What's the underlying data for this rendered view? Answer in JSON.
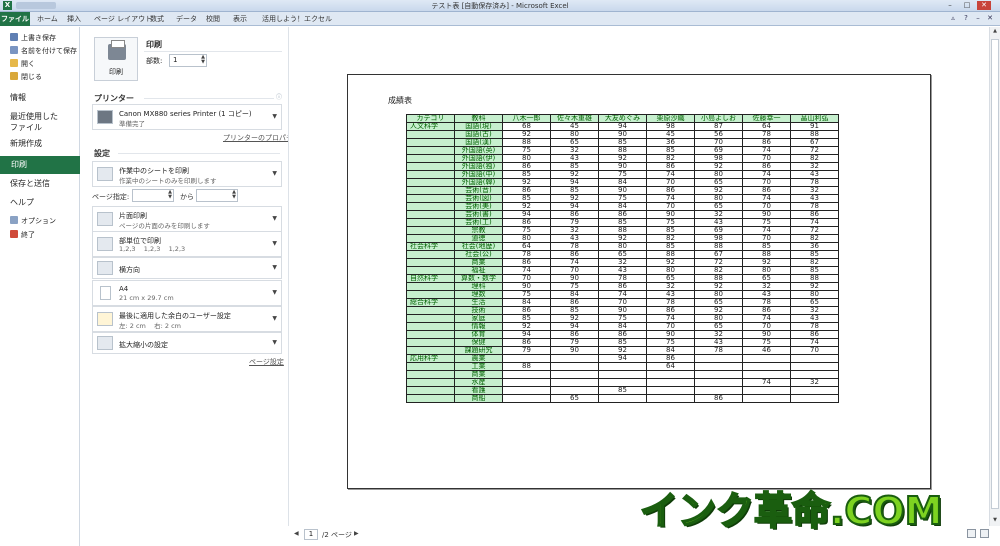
{
  "window": {
    "title": "テスト表 [自動保存済み] - Microsoft Excel",
    "controls": [
      "minimize-icon",
      "maximize-icon",
      "close-icon"
    ]
  },
  "tabs": {
    "file": "ファイル",
    "items": [
      "ホーム",
      "挿入",
      "ページ レイアウト",
      "数式",
      "データ",
      "校閲",
      "表示",
      "活用しよう！エクセル"
    ]
  },
  "nav": {
    "save": "上書き保存",
    "save_as": "名前を付けて保存",
    "open": "開く",
    "close": "閉じる",
    "info": "情報",
    "recent": "最近使用した\nファイル",
    "new": "新規作成",
    "print": "印刷",
    "save_send": "保存と送信",
    "help": "ヘルプ",
    "options": "オプション",
    "exit": "終了"
  },
  "print_panel": {
    "section_title": "印刷",
    "print_button": "印刷",
    "copies_label": "部数:",
    "copies_value": "1",
    "printer_title": "プリンター",
    "printer_name": "Canon MX880 series Printer (1 コピー)",
    "printer_status": "準備完了",
    "printer_props": "プリンターのプロパティ",
    "settings_title": "設定",
    "what_to_print": {
      "l1": "作業中のシートを印刷",
      "l2": "作業中のシートのみを印刷します"
    },
    "pages_label": "ページ指定:",
    "pages_to": "から",
    "sides": {
      "l1": "片面印刷",
      "l2": "ページの片面のみを印刷します"
    },
    "collate": {
      "l1": "部単位で印刷",
      "l2": "1,2,3    1,2,3    1,2,3"
    },
    "orientation": {
      "l1": "横方向"
    },
    "paper": {
      "l1": "A4",
      "l2": "21 cm x 29.7 cm"
    },
    "margins": {
      "l1": "最後に適用した余白のユーザー設定",
      "l2": "左: 2 cm    右: 2 cm"
    },
    "scaling": {
      "l1": "拡大縮小の設定"
    },
    "page_setup": "ページ設定"
  },
  "preview": {
    "sheet_title": "成績表",
    "headers": [
      "カテゴリ",
      "教科",
      "八木一郎",
      "佐々木重雄",
      "大友めぐみ",
      "栗原沙織",
      "小島よしお",
      "佐藤幸一",
      "畠山利弘"
    ],
    "rows": [
      [
        "人文科学",
        "国語(現)",
        "68",
        "45",
        "94",
        "98",
        "87",
        "64",
        "91"
      ],
      [
        "",
        "国語(古)",
        "92",
        "80",
        "90",
        "45",
        "56",
        "78",
        "88"
      ],
      [
        "",
        "国語(漢)",
        "88",
        "65",
        "85",
        "36",
        "70",
        "86",
        "67"
      ],
      [
        "",
        "外国語(英)",
        "75",
        "32",
        "88",
        "85",
        "69",
        "74",
        "72"
      ],
      [
        "",
        "外国語(伊)",
        "80",
        "43",
        "92",
        "82",
        "98",
        "70",
        "82"
      ],
      [
        "",
        "外国語(独)",
        "86",
        "85",
        "90",
        "86",
        "92",
        "86",
        "32"
      ],
      [
        "",
        "外国語(中)",
        "85",
        "92",
        "75",
        "74",
        "80",
        "74",
        "43"
      ],
      [
        "",
        "外国語(韓)",
        "92",
        "94",
        "84",
        "70",
        "65",
        "70",
        "78"
      ],
      [
        "",
        "芸術(音)",
        "86",
        "85",
        "90",
        "86",
        "92",
        "86",
        "32"
      ],
      [
        "",
        "芸術(図)",
        "85",
        "92",
        "75",
        "74",
        "80",
        "74",
        "43"
      ],
      [
        "",
        "芸術(美)",
        "92",
        "94",
        "84",
        "70",
        "65",
        "70",
        "78"
      ],
      [
        "",
        "芸術(書)",
        "94",
        "86",
        "86",
        "90",
        "32",
        "90",
        "86"
      ],
      [
        "",
        "芸術(工)",
        "86",
        "79",
        "85",
        "75",
        "43",
        "75",
        "74"
      ],
      [
        "",
        "宗教",
        "75",
        "32",
        "88",
        "85",
        "69",
        "74",
        "72"
      ],
      [
        "",
        "道徳",
        "80",
        "43",
        "92",
        "82",
        "98",
        "70",
        "82"
      ],
      [
        "社会科学",
        "社会(地歴)",
        "64",
        "78",
        "80",
        "85",
        "88",
        "85",
        "36"
      ],
      [
        "",
        "社会(公)",
        "78",
        "86",
        "65",
        "88",
        "67",
        "88",
        "85"
      ],
      [
        "",
        "商業",
        "86",
        "74",
        "32",
        "92",
        "72",
        "92",
        "82"
      ],
      [
        "",
        "福祉",
        "74",
        "70",
        "43",
        "80",
        "82",
        "80",
        "85"
      ],
      [
        "自然科学",
        "算数・数学",
        "70",
        "90",
        "78",
        "65",
        "88",
        "65",
        "88"
      ],
      [
        "",
        "理科",
        "90",
        "75",
        "86",
        "32",
        "92",
        "32",
        "92"
      ],
      [
        "",
        "理数",
        "75",
        "84",
        "74",
        "43",
        "80",
        "43",
        "80"
      ],
      [
        "総合科学",
        "生活",
        "84",
        "86",
        "70",
        "78",
        "65",
        "78",
        "65"
      ],
      [
        "",
        "技術",
        "86",
        "85",
        "90",
        "86",
        "92",
        "86",
        "32"
      ],
      [
        "",
        "家庭",
        "85",
        "92",
        "75",
        "74",
        "80",
        "74",
        "43"
      ],
      [
        "",
        "情報",
        "92",
        "94",
        "84",
        "70",
        "65",
        "70",
        "78"
      ],
      [
        "",
        "体育",
        "94",
        "86",
        "86",
        "90",
        "32",
        "90",
        "86"
      ],
      [
        "",
        "保健",
        "86",
        "79",
        "85",
        "75",
        "43",
        "75",
        "74"
      ],
      [
        "",
        "課題研究",
        "79",
        "90",
        "92",
        "84",
        "78",
        "46",
        "70"
      ],
      [
        "応用科学",
        "農業",
        "",
        "",
        "94",
        "86",
        "",
        "",
        ""
      ],
      [
        "",
        "工業",
        "88",
        "",
        "",
        "64",
        "",
        "",
        ""
      ],
      [
        "",
        "商業",
        "",
        "",
        "",
        "",
        "",
        "",
        ""
      ],
      [
        "",
        "水産",
        "",
        "",
        "",
        "",
        "",
        "74",
        "32"
      ],
      [
        "",
        "看護",
        "",
        "",
        "85",
        "",
        "",
        "",
        ""
      ],
      [
        "",
        "商船",
        "",
        "65",
        "",
        "",
        "86",
        "",
        ""
      ]
    ]
  },
  "pager": {
    "current": "1",
    "total": "/2 ページ"
  },
  "watermark": "インク革命.COM",
  "colors": {
    "accent": "#217346",
    "table_fill": "#c6efce",
    "table_text": "#006100",
    "watermark": "#7dd321"
  }
}
